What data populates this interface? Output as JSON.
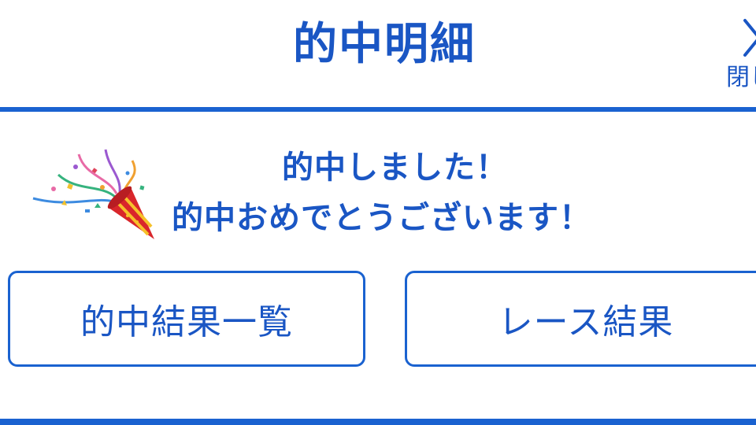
{
  "header": {
    "title": "的中明細",
    "close_label": "閉じる"
  },
  "message": {
    "line1": "的中しました！",
    "line2": "的中おめでとうございます！"
  },
  "actions": {
    "hit_results_label": "的中結果一覧",
    "race_results_label": "レース結果"
  },
  "icons": {
    "close": "close-icon",
    "celebration": "party-popper-icon"
  },
  "colors": {
    "accent": "#1a62d0",
    "text": "#1a56c4",
    "background": "#ffffff"
  }
}
